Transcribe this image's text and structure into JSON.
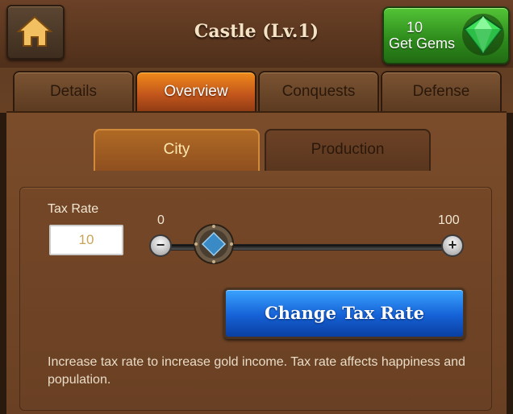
{
  "header": {
    "title": "Castle (Lv.1)",
    "home_icon": "home-icon",
    "gems": {
      "count": "10",
      "label": "Get Gems",
      "icon": "gem-icon"
    }
  },
  "tabs": [
    {
      "label": "Details",
      "active": false
    },
    {
      "label": "Overview",
      "active": true
    },
    {
      "label": "Conquests",
      "active": false
    },
    {
      "label": "Defense",
      "active": false
    }
  ],
  "subtabs": [
    {
      "label": "City",
      "active": true
    },
    {
      "label": "Production",
      "active": false
    }
  ],
  "tax": {
    "label": "Tax Rate",
    "value": "10",
    "min_label": "0",
    "max_label": "100",
    "slider_value": 10
  },
  "change_button": "Change Tax Rate",
  "description": "Increase tax rate to increase gold income. Tax rate affects happiness and population.",
  "colors": {
    "accent_orange": "#f08a1a",
    "button_blue": "#1561d6",
    "gems_green": "#2f8d1d"
  }
}
